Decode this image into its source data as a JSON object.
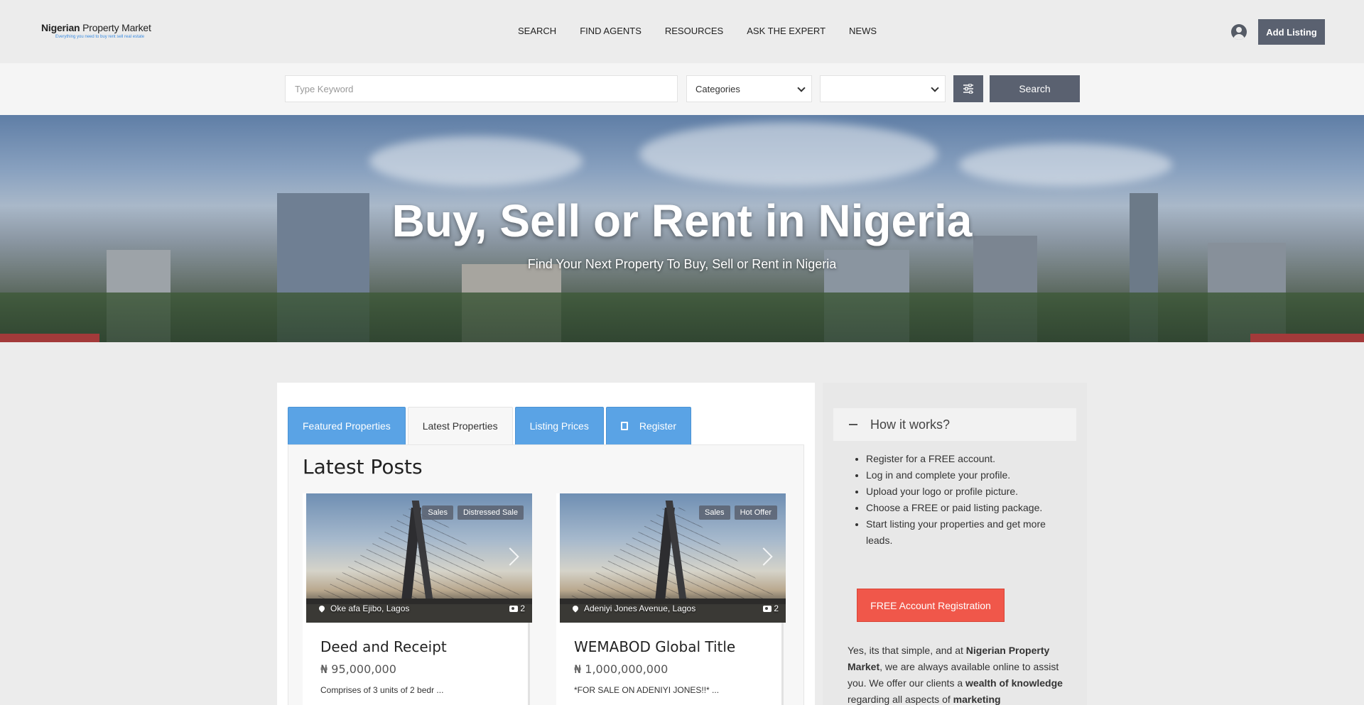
{
  "header": {
    "logo_bold": "Nigerian",
    "logo_rest": " Property Market",
    "logo_tagline": "Everything you need to buy rent sell real estate",
    "nav": [
      "SEARCH",
      "FIND AGENTS",
      "RESOURCES",
      "ASK THE EXPERT",
      "NEWS"
    ],
    "add_listing": "Add Listing"
  },
  "search": {
    "keyword_placeholder": "Type Keyword",
    "category_value": "Categories",
    "location_value": "",
    "button": "Search"
  },
  "hero": {
    "title": "Buy, Sell or Rent in Nigeria",
    "subtitle": "Find Your Next Property To Buy, Sell or Rent in Nigeria"
  },
  "tabs": [
    "Featured Properties",
    "Latest Properties",
    "Listing Prices",
    "Register"
  ],
  "active_tab": "Latest Properties",
  "latest": {
    "title": "Latest Posts",
    "cards": [
      {
        "badges": [
          "Sales",
          "Distressed Sale"
        ],
        "location": "Oke afa Ejibo, Lagos",
        "photo_count": "2",
        "title": "Deed and Receipt",
        "price": "₦ 95,000,000",
        "description": "Comprises of 3 units of 2 bedr ..."
      },
      {
        "badges": [
          "Sales",
          "Hot Offer"
        ],
        "location": "Adeniyi Jones Avenue, Lagos",
        "photo_count": "2",
        "title": "WEMABOD Global Title",
        "price": "₦ 1,000,000,000",
        "description": "*FOR SALE ON ADENIYI JONES!!* ..."
      }
    ]
  },
  "sidebar": {
    "how_title": "How it works?",
    "steps": [
      "Register for a FREE account.",
      "Log in and complete your profile.",
      "Upload your logo or profile picture.",
      "Choose a FREE or paid listing package.",
      "Start listing your properties and get more leads."
    ],
    "register_button": "FREE Account Registration",
    "text_1": "Yes, its that simple, and at ",
    "text_bold_1": "Nigerian Property Market",
    "text_2": ", we are always available online to assist you. We offer our clients a ",
    "text_bold_2": "wealth of knowledge",
    "text_3": " regarding all aspects of ",
    "text_bold_3": "marketing"
  },
  "colors": {
    "accent_dark": "#5a6170",
    "tab_blue": "#5aa3e5",
    "register_red": "#f0574a"
  }
}
